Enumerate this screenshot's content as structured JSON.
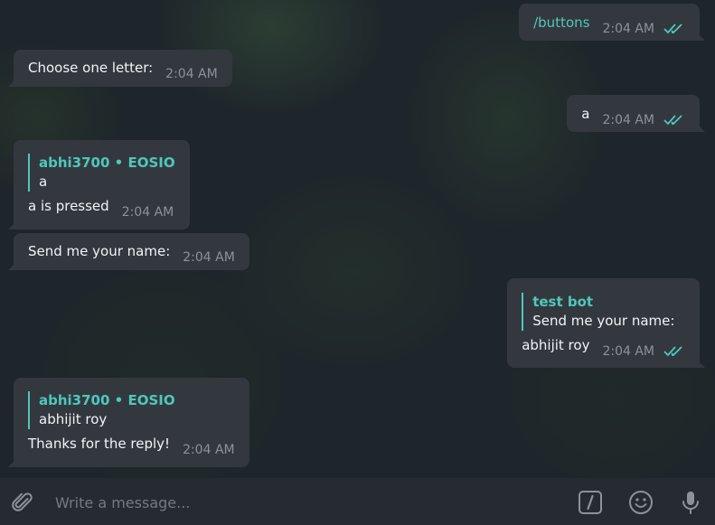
{
  "messages": [
    {
      "direction": "out",
      "text": "/buttons",
      "time": "2:04 AM",
      "is_command": true,
      "read": true
    },
    {
      "direction": "in",
      "text": "Choose one letter:",
      "time": "2:04 AM"
    },
    {
      "direction": "out",
      "text": "a",
      "time": "2:04 AM",
      "read": true
    },
    {
      "direction": "in",
      "reply_to": {
        "author": "abhi3700 • EOSIO",
        "text": "a"
      },
      "text": "a is pressed",
      "time": "2:04 AM"
    },
    {
      "direction": "in",
      "text": "Send me your name:",
      "time": "2:04 AM"
    },
    {
      "direction": "out",
      "reply_to": {
        "author": "test bot",
        "text": "Send me your name:"
      },
      "text": "abhijit roy",
      "time": "2:04 AM",
      "read": true
    },
    {
      "direction": "in",
      "reply_to": {
        "author": "abhi3700 • EOSIO",
        "text": "abhijit roy"
      },
      "text": "Thanks for the reply!",
      "time": "2:04 AM"
    }
  ],
  "composer": {
    "placeholder": "Write a message...",
    "value": "",
    "attach_icon": "paperclip-icon",
    "command_icon": "slash-command-icon",
    "emoji_icon": "emoji-icon",
    "mic_icon": "microphone-icon"
  },
  "colors": {
    "accent": "#4fc8b9",
    "bubble": "#33383f",
    "composer": "#262b32",
    "timestamp": "#8c929a"
  }
}
